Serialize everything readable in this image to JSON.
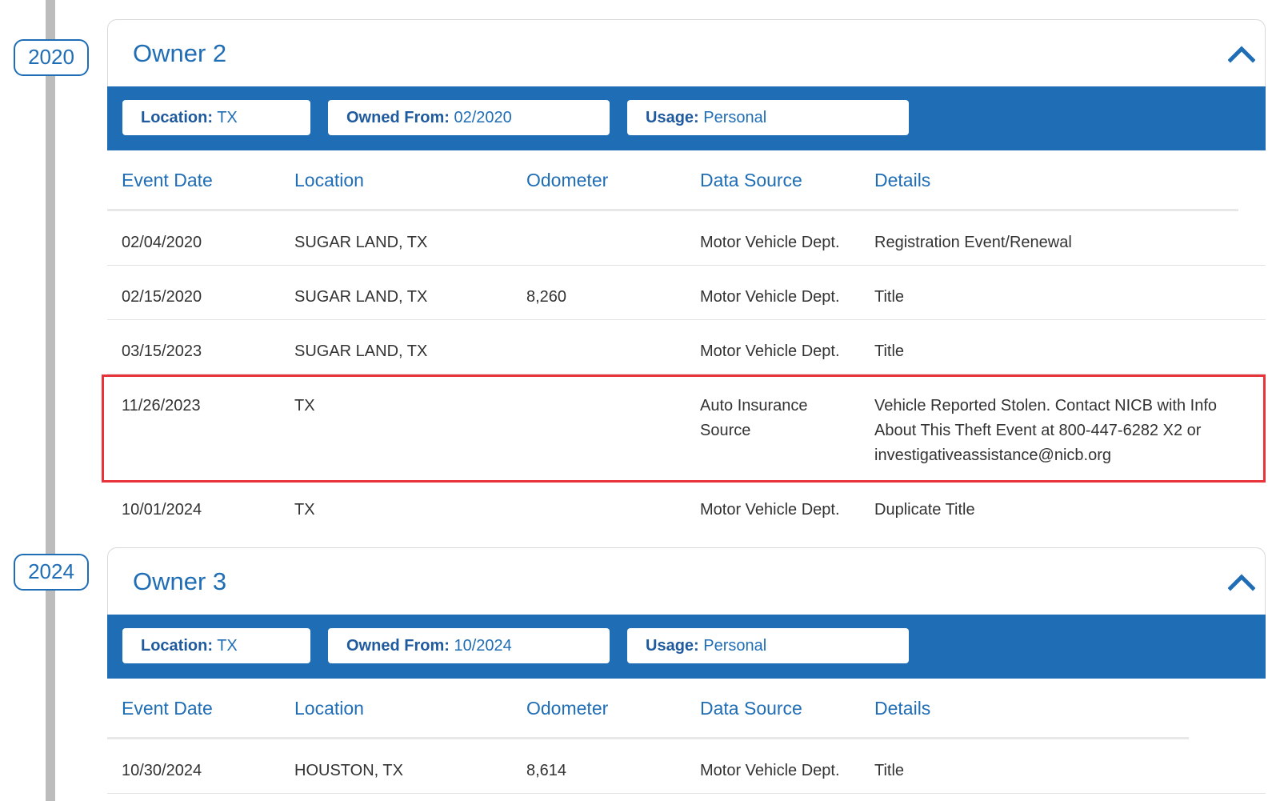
{
  "timeline": {
    "years": [
      "2020",
      "2024"
    ]
  },
  "columns": {
    "event_date": "Event Date",
    "location": "Location",
    "odometer": "Odometer",
    "data_source": "Data Source",
    "details": "Details"
  },
  "owners": [
    {
      "title": "Owner 2",
      "location_label": "Location:",
      "location_value": "TX",
      "owned_label": "Owned From:",
      "owned_value": "02/2020",
      "usage_label": "Usage:",
      "usage_value": "Personal",
      "rows": [
        {
          "date": "02/04/2020",
          "location": "SUGAR LAND, TX",
          "odometer": "",
          "source": "Motor Vehicle Dept.",
          "details": "Registration Event/Renewal"
        },
        {
          "date": "02/15/2020",
          "location": "SUGAR LAND, TX",
          "odometer": "8,260",
          "source": "Motor Vehicle Dept.",
          "details": "Title"
        },
        {
          "date": "03/15/2023",
          "location": "SUGAR LAND, TX",
          "odometer": "",
          "source": "Motor Vehicle Dept.",
          "details": "Title"
        },
        {
          "date": "11/26/2023",
          "location": "TX",
          "odometer": "",
          "source": "Auto Insurance Source",
          "details": "Vehicle Reported Stolen. Contact NICB with Info About This Theft Event at 800-447-6282 X2 or investigativeassistance@nicb.org"
        },
        {
          "date": "10/01/2024",
          "location": "TX",
          "odometer": "",
          "source": "Motor Vehicle Dept.",
          "details": "Duplicate Title"
        }
      ]
    },
    {
      "title": "Owner 3",
      "location_label": "Location:",
      "location_value": "TX",
      "owned_label": "Owned From:",
      "owned_value": "10/2024",
      "usage_label": "Usage:",
      "usage_value": "Personal",
      "rows": [
        {
          "date": "10/30/2024",
          "location": "HOUSTON, TX",
          "odometer": "8,614",
          "source": "Motor Vehicle Dept.",
          "details": "Title"
        }
      ]
    }
  ],
  "colors": {
    "brand_blue": "#1f6db5",
    "highlight_red": "#e8333a",
    "timeline_gray": "#bcbcbc"
  }
}
